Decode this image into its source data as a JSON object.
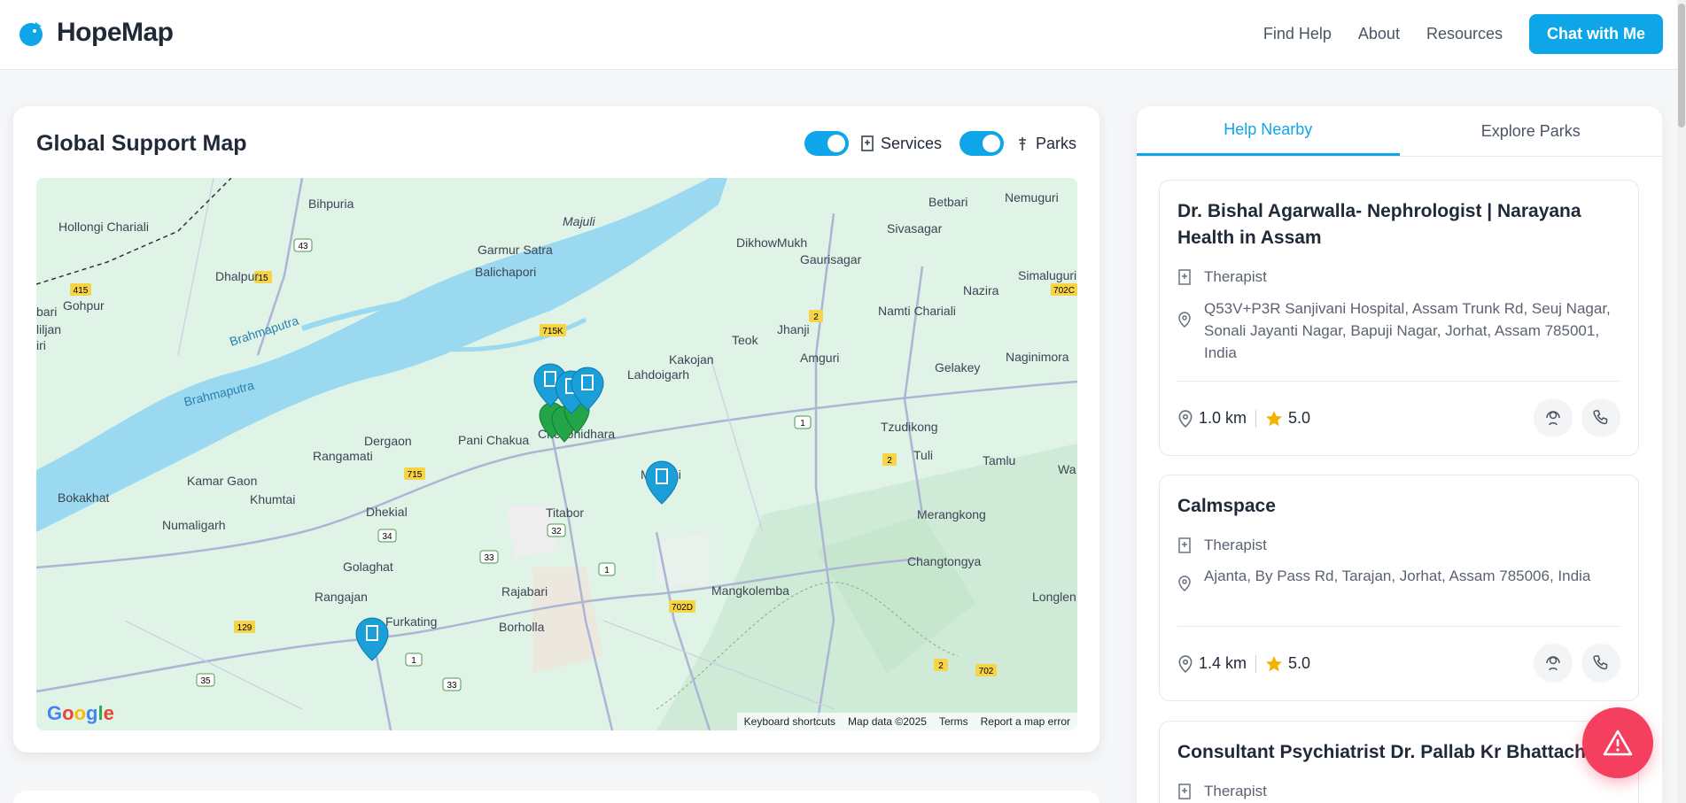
{
  "header": {
    "brand": "HopeMap",
    "nav": [
      "Find Help",
      "About",
      "Resources"
    ],
    "cta": "Chat with Me"
  },
  "map_card": {
    "title": "Global Support Map",
    "toggles": [
      {
        "label": "Services",
        "on": true
      },
      {
        "label": "Parks",
        "on": true
      }
    ],
    "footer": [
      "Keyboard shortcuts",
      "Map data ©2025",
      "Terms",
      "Report a map error"
    ],
    "logo": "Google",
    "places": [
      "Hollongi Chariali",
      "Bihpuria",
      "Garmur Satra",
      "Majuli",
      "Balichapori",
      "DikhowMukh",
      "Betbari",
      "Nemuguri",
      "Sivasagar",
      "Dhalpur",
      "Gohpur",
      "Gaurisagar",
      "Simaluguri",
      "Nazira",
      "Brahmaputra",
      "Brahmaputra",
      "Teok",
      "Jhanji",
      "Namti Chariali",
      "Kakojan",
      "Lahdoigarh",
      "Amguri",
      "Gelakey",
      "Naginimora",
      "Tzudikong",
      "Dergaon",
      "Pani Chakua",
      "Chekonidhara",
      "Rangamati",
      "Mariani",
      "Tuli",
      "Tamlu",
      "Bokakhat",
      "Kamar Gaon",
      "Khumtai",
      "Numaligarh",
      "Dhekial",
      "Titabor",
      "Merangkong",
      "Golaghat",
      "Rangajan",
      "Furkating",
      "Rajabari",
      "Borholla",
      "Mangkolemba",
      "Changtongya",
      "Longlen",
      "liljan",
      "bari",
      "iri",
      "Wa"
    ],
    "roads": [
      "43",
      "15",
      "415",
      "715K",
      "2",
      "702C",
      "1",
      "715",
      "34",
      "33",
      "32",
      "1",
      "702D",
      "2",
      "129",
      "35",
      "1",
      "33",
      "2",
      "702"
    ]
  },
  "panel": {
    "tabs": [
      "Help Nearby",
      "Explore Parks"
    ],
    "results": [
      {
        "name": "Dr. Bishal Agarwalla- Nephrologist | Narayana Health in Assam",
        "type": "Therapist",
        "address": "Q53V+P3R Sanjivani Hospital, Assam Trunk Rd, Seuj Nagar, Sonali Jayanti Nagar, Bapuji Nagar, Jorhat, Assam 785001, India",
        "distance": "1.0 km",
        "rating": "5.0"
      },
      {
        "name": "Calmspace",
        "type": "Therapist",
        "address": "Ajanta, By Pass Rd, Tarajan, Jorhat, Assam 785006, India",
        "distance": "1.4 km",
        "rating": "5.0"
      },
      {
        "name": "Consultant Psychiatrist Dr. Pallab Kr Bhattachary",
        "type": "Therapist"
      }
    ]
  },
  "colors": {
    "accent": "#0ea5e9",
    "sos": "#f43f5e",
    "park": "#22a447",
    "river": "#9ad9f0",
    "star": "#f5b301"
  }
}
